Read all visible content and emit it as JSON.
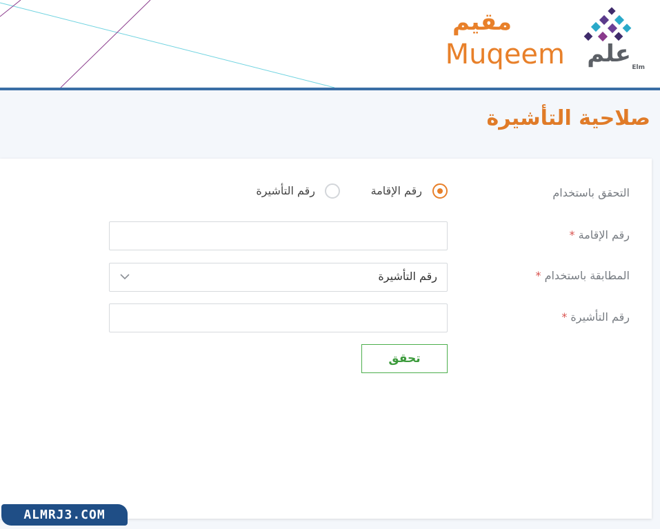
{
  "header": {
    "logo_muqeem_arabic": "مقيم",
    "logo_muqeem_english": "Muqeem",
    "logo_elm_arabic": "علم",
    "logo_elm_english": "Elm"
  },
  "page": {
    "title": "صلاحية التأشيرة"
  },
  "form": {
    "verify_using_label": "التحقق باستخدام",
    "radio_options": [
      {
        "label": "رقم الإقامة",
        "selected": true
      },
      {
        "label": "رقم التأشيرة",
        "selected": false
      }
    ],
    "iqama_number": {
      "label": "رقم الإقامة",
      "required_mark": "*",
      "value": ""
    },
    "match_using": {
      "label": "المطابقة باستخدام",
      "required_mark": "*",
      "selected": "رقم التأشيرة"
    },
    "visa_number": {
      "label": "رقم التأشيرة",
      "required_mark": "*",
      "value": ""
    },
    "submit_label": "تحقق"
  },
  "watermark": "ALMRJ3.COM",
  "colors": {
    "accent_orange": "#e8802a",
    "header_border": "#3a6ea5",
    "button_green": "#4cae4c"
  },
  "icons": [
    "chevron-down-icon",
    "elm-logo-icon"
  ]
}
